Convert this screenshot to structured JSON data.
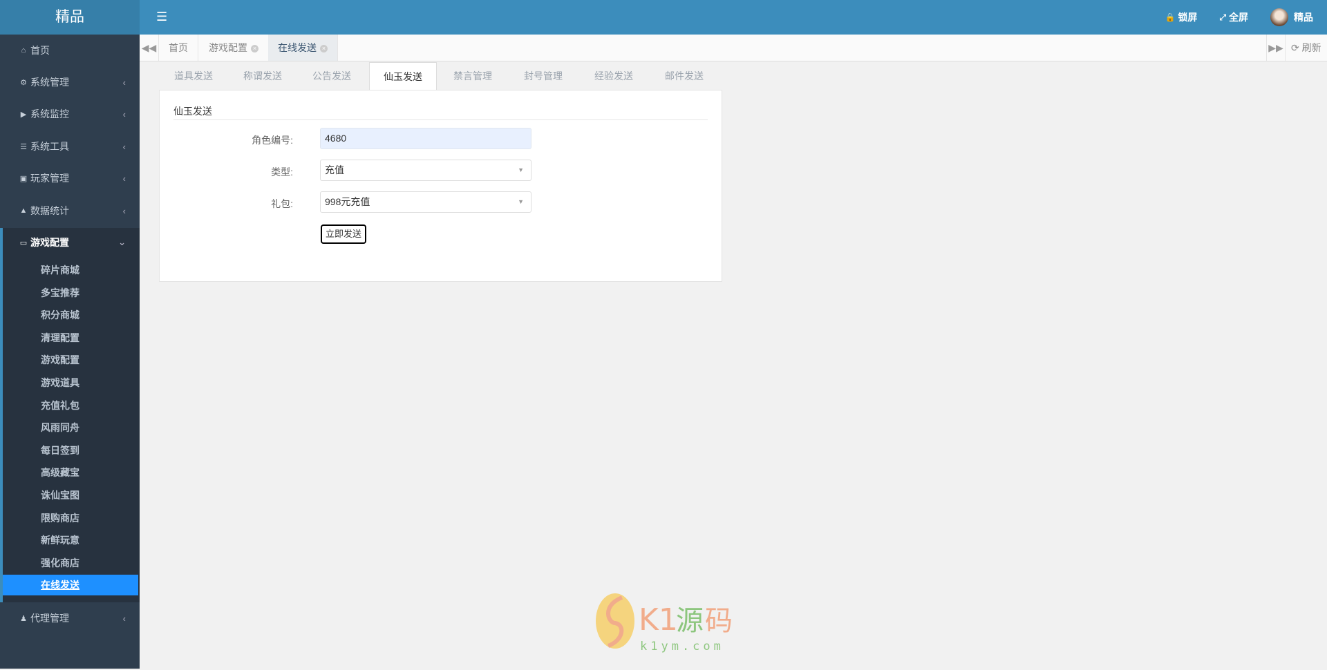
{
  "header": {
    "brand": "精品",
    "lock_label": "锁屏",
    "fullscreen_label": "全屏",
    "user_name": "精品"
  },
  "sidebar": {
    "items": [
      {
        "label": "首页",
        "icon": "home-icon"
      },
      {
        "label": "系统管理",
        "icon": "gear-icon"
      },
      {
        "label": "系统监控",
        "icon": "video-icon"
      },
      {
        "label": "系统工具",
        "icon": "list-icon"
      },
      {
        "label": "玩家管理",
        "icon": "address-book-icon"
      },
      {
        "label": "数据统计",
        "icon": "area-chart-icon"
      },
      {
        "label": "游戏配置",
        "icon": "desktop-icon"
      },
      {
        "label": "代理管理",
        "icon": "users-icon"
      }
    ],
    "sub_items": [
      "碎片商城",
      "多宝推荐",
      "积分商城",
      "清理配置",
      "游戏配置",
      "游戏道具",
      "充值礼包",
      "风雨同舟",
      "每日签到",
      "高级藏宝",
      "诛仙宝图",
      "限购商店",
      "新鲜玩意",
      "强化商店",
      "在线发送"
    ],
    "active_sub": "在线发送"
  },
  "page_tabs": [
    {
      "label": "首页"
    },
    {
      "label": "游戏配置"
    },
    {
      "label": "在线发送"
    }
  ],
  "refresh_label": "刷新",
  "content_tabs": [
    "道具发送",
    "称谓发送",
    "公告发送",
    "仙玉发送",
    "禁言管理",
    "封号管理",
    "经验发送",
    "邮件发送"
  ],
  "form": {
    "title": "仙玉发送",
    "role_label": "角色编号:",
    "role_value": "4680",
    "type_label": "类型:",
    "type_value": "充值",
    "gift_label": "礼包:",
    "gift_value": "998元充值",
    "submit_label": "立即发送"
  },
  "watermark": {
    "text": "K1源码",
    "url_text": "k1ym.com"
  },
  "colors": {
    "topbar": "#3c8dbc",
    "sidebar": "#2f3e4e",
    "active": "#1e90ff"
  }
}
